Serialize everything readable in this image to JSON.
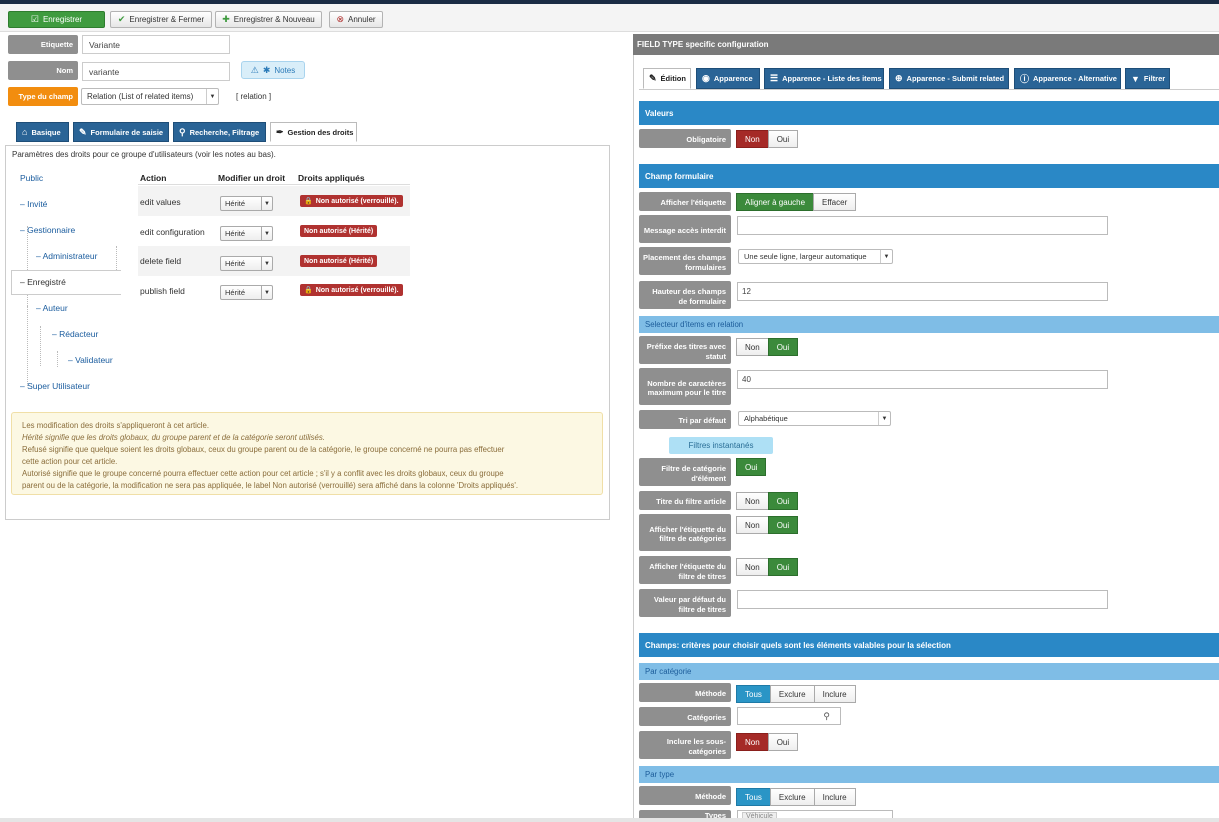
{
  "toolbar": {
    "save": "Enregistrer",
    "save_close": "Enregistrer & Fermer",
    "save_new": "Enregistrer & Nouveau",
    "cancel": "Annuler"
  },
  "form": {
    "label_label": "Etiquette",
    "label_value": "Variante",
    "name_label": "Nom",
    "name_value": "variante",
    "notes_button": "Notes",
    "type_label": "Type du champ",
    "type_value": "Relation (List of related items)",
    "type_code": "[ relation ]"
  },
  "left_tabs": [
    {
      "label": "Basique",
      "icon": "home-icon"
    },
    {
      "label": "Formulaire de saisie",
      "icon": "edit-icon"
    },
    {
      "label": "Recherche, Filtrage",
      "icon": "search-icon"
    },
    {
      "label": "Gestion des droits",
      "icon": "pen-icon"
    }
  ],
  "permissions": {
    "intro": "Paramètres des droits pour ce groupe d'utilisateurs (voir les notes au bas).",
    "groups": [
      "Public",
      "– Invité",
      "– Gestionnaire",
      "– Administrateur",
      "– Enregistré",
      "– Auteur",
      "– Rédacteur",
      "– Validateur",
      "– Super Utilisateur"
    ],
    "headers": {
      "action": "Action",
      "modify": "Modifier un droit",
      "applied": "Droits appliqués"
    },
    "rows": [
      {
        "action": "edit values",
        "select": "Hérité",
        "applied": "Non autorisé (verrouillé)."
      },
      {
        "action": "edit configuration",
        "select": "Hérité",
        "applied": "Non autorisé (Hérité)"
      },
      {
        "action": "delete field",
        "select": "Hérité",
        "applied": "Non autorisé (Hérité)"
      },
      {
        "action": "publish field",
        "select": "Hérité",
        "applied": "Non autorisé (verrouillé)."
      }
    ],
    "notes": [
      "Les modification des droits s'appliqueront à cet article.",
      "Hérité signifie que les droits globaux, du groupe parent et de la catégorie seront utilisés.",
      "Refusé signifie que quelque soient les droits globaux, ceux du groupe parent ou de la catégorie, le groupe concerné ne pourra pas effectuer",
      "cette action pour cet article.",
      "Autorisé signifie que le groupe concerné pourra effectuer cette action pour cet article ; s'il y a conflit avec les droits globaux, ceux du groupe",
      "parent ou de la catégorie, la modification ne sera pas appliquée, le label Non autorisé (verrouillé) sera affiché dans la colonne 'Droits appliqués'."
    ]
  },
  "right": {
    "header": "FIELD TYPE specific configuration",
    "tabs": [
      "Édition",
      "Apparence",
      "Apparence - Liste des items",
      "Apparence - Submit related",
      "Apparence - Alternative",
      "Filtrer"
    ],
    "sections": {
      "values": "Valeurs",
      "form_field": "Champ formulaire",
      "selector": "Selecteur d'items en relation",
      "fields_criteria": "Champs: critères pour choisir quels sont les éléments valables pour la sélection",
      "by_category": "Par catégorie",
      "by_type": "Par type"
    },
    "labels": {
      "required": "Obligatoire",
      "show_label": "Afficher l'étiquette",
      "access_msg": "Message accès interdit",
      "placement": "Placement des champs formulaires",
      "height": "Hauteur des champs de formulaire",
      "prefix": "Préfixe des titres avec statut",
      "max_chars": "Nombre de caractères maximum pour le titre",
      "sort": "Tri par défaut",
      "cat_filter": "Filtre de catégorie d'élément",
      "title_filter": "Titre du filtre article",
      "show_cat_filter_label": "Afficher l'étiquette du filtre de catégories",
      "show_title_filter_label": "Afficher l'étiquette du filtre de titres",
      "default_title_filter": "Valeur par défaut du filtre de titres",
      "method": "Méthode",
      "categories": "Catégories",
      "include_sub": "Inclure les sous-catégories",
      "method2": "Méthode",
      "types": "Types"
    },
    "values": {
      "no": "Non",
      "yes": "Oui",
      "align_left": "Aligner à gauche",
      "clear": "Effacer",
      "placement_value": "Une seule ligne, largeur automatique",
      "height_value": "12",
      "max_chars_value": "40",
      "sort_value": "Alphabétique",
      "instant_filters": "Filtres instantanés",
      "all": "Tous",
      "exclude": "Exclure",
      "include": "Inclure",
      "type_tag": "Véhicule"
    }
  }
}
